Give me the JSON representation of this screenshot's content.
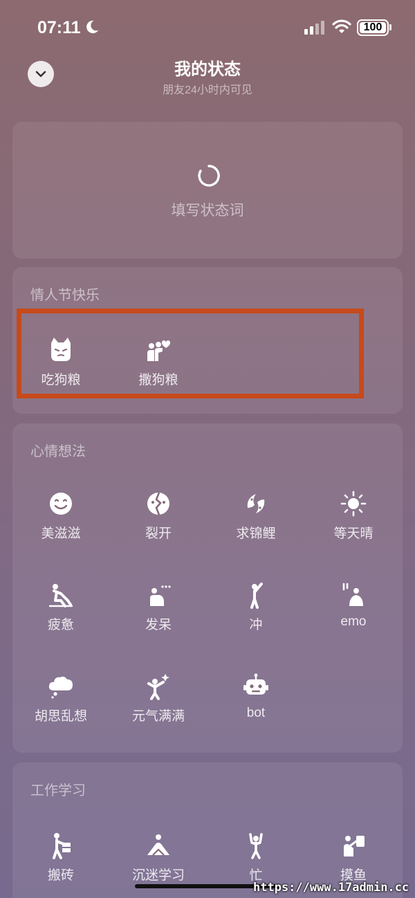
{
  "status_bar": {
    "time": "07:11",
    "battery": "100"
  },
  "header": {
    "title": "我的状态",
    "subtitle": "朋友24小时内可见"
  },
  "status_input": {
    "placeholder": "填写状态词"
  },
  "sections": {
    "valentine": {
      "title": "情人节快乐",
      "items": [
        {
          "label": "吃狗粮",
          "icon": "cat-face-icon"
        },
        {
          "label": "撒狗粮",
          "icon": "couple-heart-icon"
        }
      ]
    },
    "mood": {
      "title": "心情想法",
      "items": [
        {
          "label": "美滋滋",
          "icon": "smiley-icon"
        },
        {
          "label": "裂开",
          "icon": "cracked-face-icon"
        },
        {
          "label": "求锦鲤",
          "icon": "koi-icon"
        },
        {
          "label": "等天晴",
          "icon": "sun-icon"
        },
        {
          "label": "疲惫",
          "icon": "tired-person-icon"
        },
        {
          "label": "发呆",
          "icon": "dazed-person-icon"
        },
        {
          "label": "冲",
          "icon": "charging-person-icon"
        },
        {
          "label": "emo",
          "icon": "emo-person-icon"
        },
        {
          "label": "胡思乱想",
          "icon": "thought-cloud-icon"
        },
        {
          "label": "元气满满",
          "icon": "energetic-person-icon"
        },
        {
          "label": "bot",
          "icon": "robot-icon"
        }
      ]
    },
    "work": {
      "title": "工作学习",
      "items": [
        {
          "label": "搬砖",
          "icon": "brick-carrier-icon"
        },
        {
          "label": "沉迷学习",
          "icon": "studying-person-icon"
        },
        {
          "label": "忙",
          "icon": "busy-person-icon"
        },
        {
          "label": "摸鱼",
          "icon": "slacking-person-icon"
        }
      ]
    }
  },
  "watermark": "https://www.17admin.cc"
}
